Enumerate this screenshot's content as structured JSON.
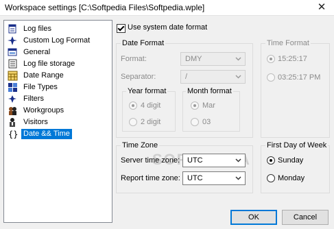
{
  "window": {
    "title": "Workspace settings [C:\\Softpedia Files\\Softpedia.wple]",
    "close_glyph": "✕"
  },
  "tree": {
    "items": [
      {
        "label": "Log files",
        "icon": "log-files-icon"
      },
      {
        "label": "Custom Log Format",
        "icon": "custom-format-icon"
      },
      {
        "label": "General",
        "icon": "general-icon"
      },
      {
        "label": "Log file storage",
        "icon": "storage-icon"
      },
      {
        "label": "Date Range",
        "icon": "calendar-icon"
      },
      {
        "label": "File Types",
        "icon": "file-types-icon"
      },
      {
        "label": "Filters",
        "icon": "filters-icon"
      },
      {
        "label": "Workgroups",
        "icon": "workgroups-icon"
      },
      {
        "label": "Visitors",
        "icon": "visitors-icon"
      },
      {
        "label": "Date && Time",
        "icon": "braces-icon",
        "selected": true
      }
    ]
  },
  "use_system": {
    "label": "Use system date format",
    "checked": true
  },
  "date_format": {
    "title": "Date Format",
    "format_label": "Format:",
    "format_value": "DMY",
    "separator_label": "Separator:",
    "separator_value": "/",
    "year": {
      "title": "Year format",
      "options": [
        "4 digit",
        "2 digit"
      ],
      "selected": "4 digit"
    },
    "month": {
      "title": "Month format",
      "options": [
        "Mar",
        "03"
      ],
      "selected": "Mar"
    }
  },
  "time_format": {
    "title": "Time Format",
    "options": [
      "15:25:17",
      "03:25:17 PM"
    ],
    "selected": "15:25:17"
  },
  "time_zone": {
    "title": "Time Zone",
    "server_label": "Server time zone:",
    "server_value": "UTC",
    "report_label": "Report time zone:",
    "report_value": "UTC"
  },
  "first_day": {
    "title": "First Day of Week",
    "options": [
      "Sunday",
      "Monday"
    ],
    "selected": "Sunday"
  },
  "buttons": {
    "ok": "OK",
    "cancel": "Cancel"
  },
  "watermark": "SOFTPEDIA",
  "colors": {
    "selection": "#0078d7",
    "disabled_text": "#8a8a8a"
  }
}
